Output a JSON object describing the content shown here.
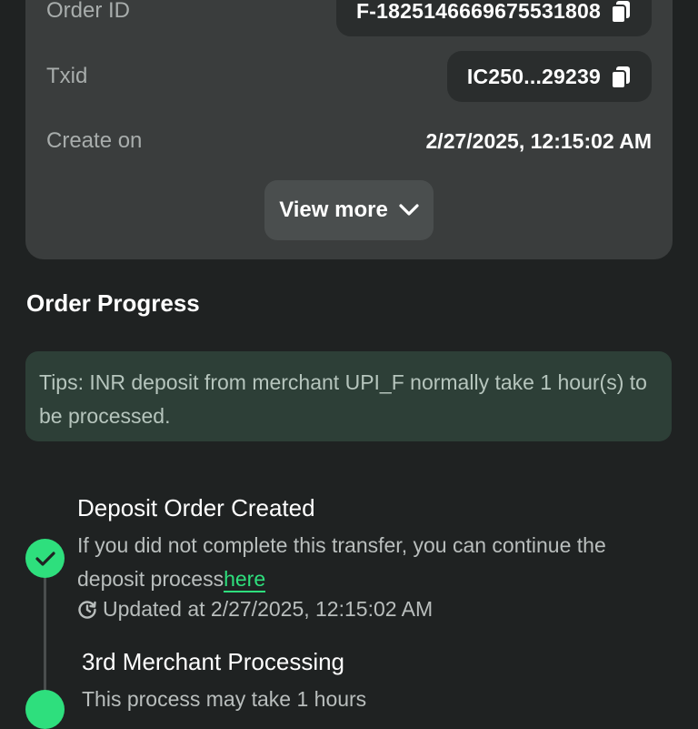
{
  "order_info": {
    "order_id_label": "Order ID",
    "order_id_value": "F-1825146669675531808",
    "txid_label": "Txid",
    "txid_value": "IC250...29239",
    "create_label": "Create on",
    "create_value": "2/27/2025, 12:15:02 AM",
    "view_more_label": "View more"
  },
  "progress": {
    "title": "Order Progress",
    "tips": "Tips: INR deposit from merchant UPI_F normally take 1 hour(s) to be processed.",
    "steps": [
      {
        "title": "Deposit Order Created",
        "description": "If you did not complete this transfer, you can continue the deposit process",
        "link_text": "here",
        "updated": "Updated at 2/27/2025, 12:15:02 AM",
        "status": "completed"
      },
      {
        "title": "3rd Merchant Processing",
        "description": "This process may take 1 hours",
        "status": "completed"
      }
    ]
  },
  "colors": {
    "accent": "#2edf7d",
    "card": "#3a3d3d",
    "background": "#1f2222",
    "tips_bg": "#2d3f37"
  },
  "icons": [
    "copy-icon",
    "chevron-down-icon",
    "check-icon",
    "clock-icon"
  ]
}
